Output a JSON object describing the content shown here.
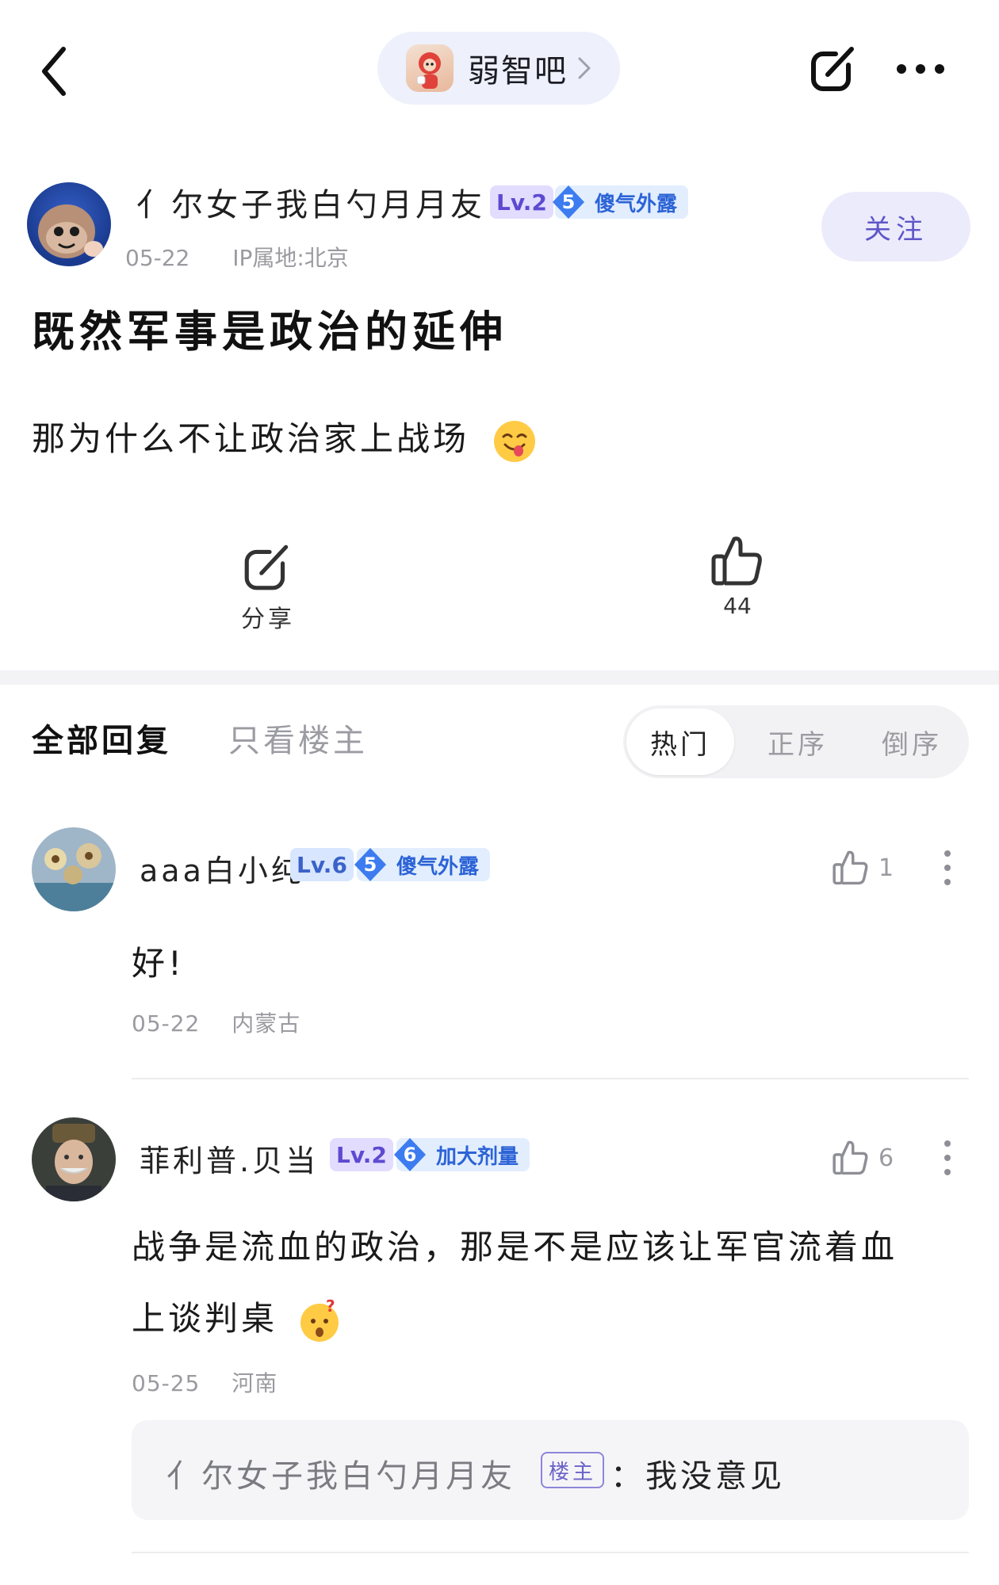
{
  "nav": {
    "forum_name": "弱智吧"
  },
  "post": {
    "author": {
      "name": "亻尔女子我白勺月月友",
      "level": "Lv.2",
      "honor_level": "5",
      "honor_title": "傻气外露",
      "date": "05-22",
      "ip": "IP属地:北京"
    },
    "follow_label": "关注",
    "title": "既然军事是政治的延伸",
    "body": "那为什么不让政治家上战场",
    "share_label": "分享",
    "like_count": "44"
  },
  "replies_tabs": {
    "all": "全部回复",
    "op_only": "只看楼主",
    "sort": [
      "热门",
      "正序",
      "倒序"
    ],
    "active_sort": "热门"
  },
  "comments": [
    {
      "name": "aaa白小纯",
      "level": "Lv.6",
      "honor_level": "5",
      "honor_title": "傻气外露",
      "likes": "1",
      "text": "好!",
      "date": "05-22",
      "location": "内蒙古"
    },
    {
      "name": "菲利普.贝当",
      "level": "Lv.2",
      "honor_level": "6",
      "honor_title": "加大剂量",
      "likes": "6",
      "text_line1": "战争是流血的政治，那是不是应该让军官流着血",
      "text_line2": "上谈判桌",
      "date": "05-25",
      "location": "河南",
      "sub_reply": {
        "name": "亻尔女子我白勺月月友",
        "tag": "楼主",
        "text": "：我没意见"
      }
    }
  ],
  "colors": {
    "accent": "#5e56c8",
    "honor_blue": "#2c63d6",
    "muted": "#9a9aa0"
  }
}
